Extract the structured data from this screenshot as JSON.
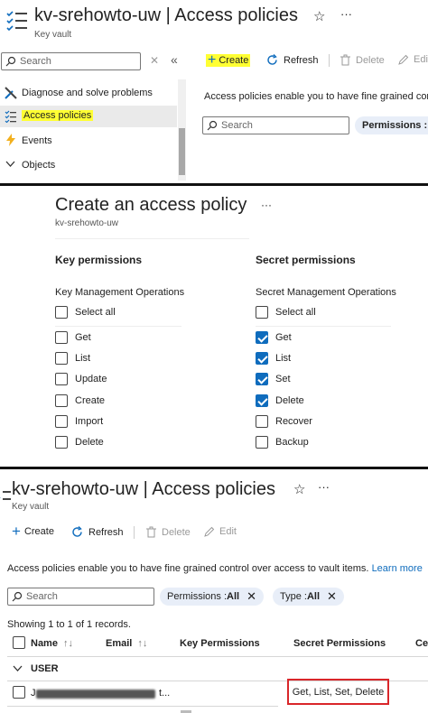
{
  "panel1": {
    "title": "kv-srehowto-uw | Access policies",
    "subtitle": "Key vault",
    "search_placeholder": "Search",
    "menu": [
      {
        "label": "Diagnose and solve problems"
      },
      {
        "label": "Access policies"
      },
      {
        "label": "Events"
      },
      {
        "label": "Objects"
      }
    ],
    "toolbar": {
      "create": "Create",
      "refresh": "Refresh",
      "delete": "Delete",
      "edit": "Edi"
    },
    "info_text": "Access policies enable you to have fine grained contro",
    "content_search_placeholder": "Search",
    "permissions_pill": "Permissions : A"
  },
  "panel2": {
    "title": "Create an access policy",
    "subtitle": "kv-srehowto-uw",
    "key_permissions": {
      "heading": "Key permissions",
      "group": "Key Management Operations",
      "select_all": "Select all",
      "items": [
        {
          "label": "Get",
          "checked": false
        },
        {
          "label": "List",
          "checked": false
        },
        {
          "label": "Update",
          "checked": false
        },
        {
          "label": "Create",
          "checked": false
        },
        {
          "label": "Import",
          "checked": false
        },
        {
          "label": "Delete",
          "checked": false
        }
      ]
    },
    "secret_permissions": {
      "heading": "Secret permissions",
      "group": "Secret Management Operations",
      "select_all": "Select all",
      "items": [
        {
          "label": "Get",
          "checked": true
        },
        {
          "label": "List",
          "checked": true
        },
        {
          "label": "Set",
          "checked": true
        },
        {
          "label": "Delete",
          "checked": true
        },
        {
          "label": "Recover",
          "checked": false
        },
        {
          "label": "Backup",
          "checked": false
        }
      ]
    }
  },
  "panel3": {
    "title": "kv-srehowto-uw | Access policies",
    "subtitle": "Key vault",
    "toolbar": {
      "create": "Create",
      "refresh": "Refresh",
      "delete": "Delete",
      "edit": "Edit"
    },
    "info_text": "Access policies enable you to have fine grained control over access to vault items.",
    "learn_more": "Learn more",
    "search_placeholder": "Search",
    "filters": {
      "permissions_label": "Permissions : ",
      "permissions_value": "All",
      "type_label": "Type : ",
      "type_value": "All"
    },
    "records_text": "Showing 1 to 1 of 1 records.",
    "columns": [
      "Name",
      "Email",
      "Key Permissions",
      "Secret Permissions",
      "Ce"
    ],
    "group_label": "USER",
    "row": {
      "name": "J",
      "email": "t...",
      "key_permissions": "",
      "secret_permissions": "Get, List, Set, Delete"
    }
  }
}
